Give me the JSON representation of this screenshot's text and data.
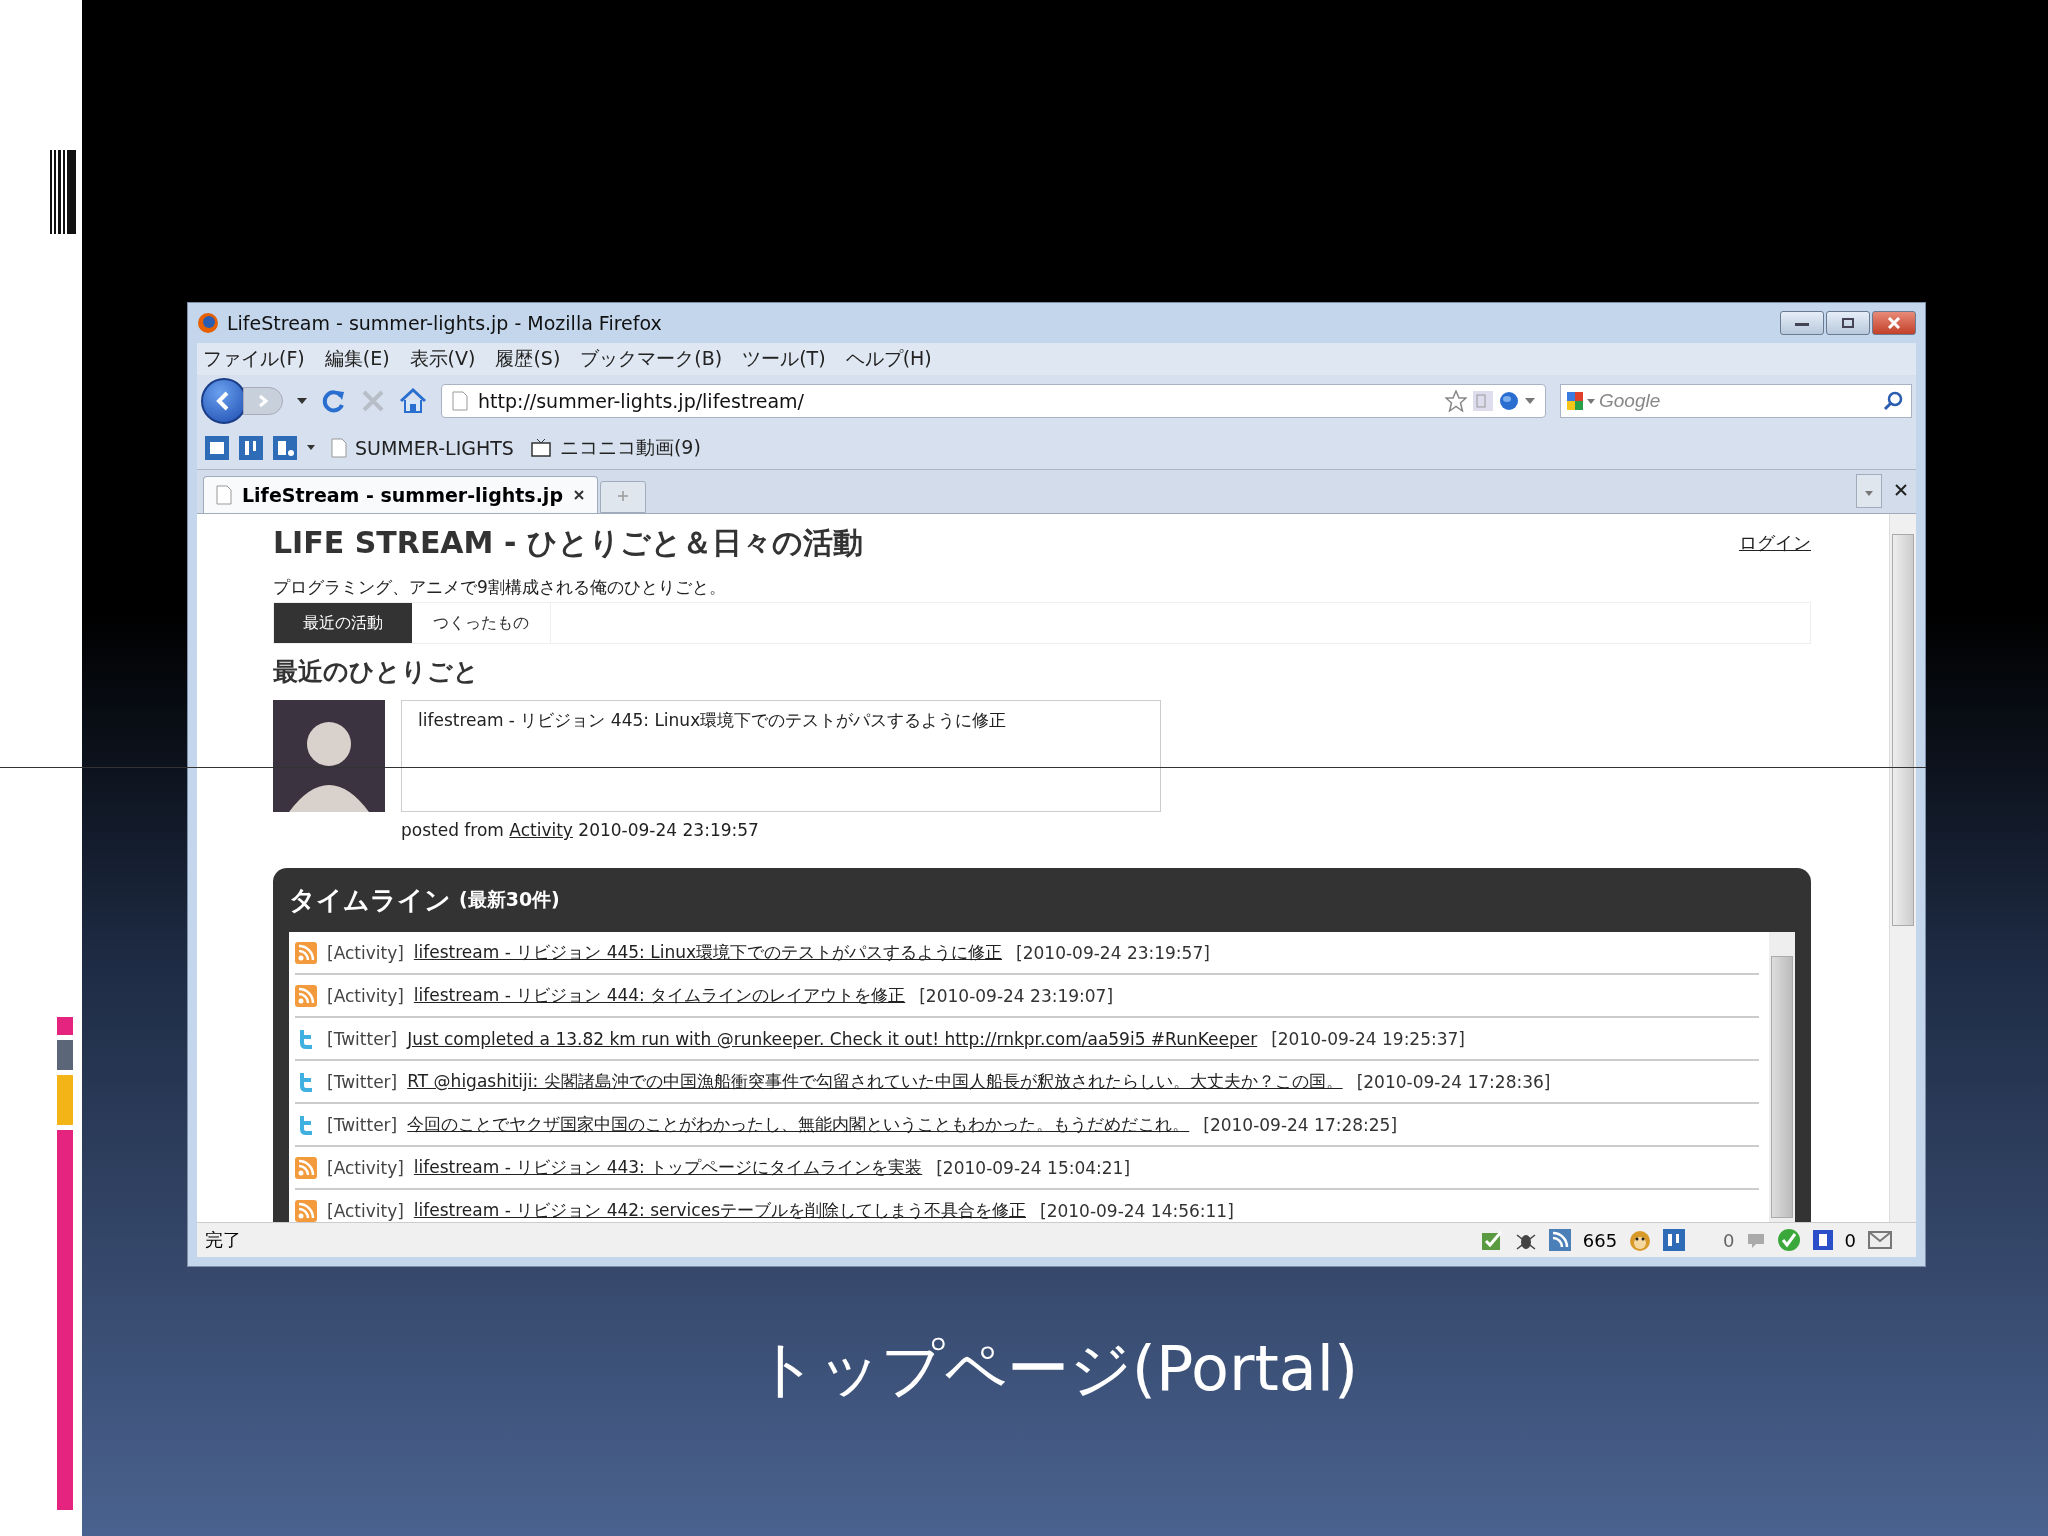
{
  "slide": {
    "caption": "トップページ(Portal)"
  },
  "window": {
    "title": "LifeStream - summer-lights.jp - Mozilla Firefox"
  },
  "menu": [
    "ファイル(F)",
    "編集(E)",
    "表示(V)",
    "履歴(S)",
    "ブックマーク(B)",
    "ツール(T)",
    "ヘルプ(H)"
  ],
  "address_bar": {
    "value": "http://summer-lights.jp/lifestream/"
  },
  "search": {
    "placeholder": "Google"
  },
  "bookmarks": [
    {
      "label": "SUMMER-LIGHTS",
      "kind": "page"
    },
    {
      "label": "ニコニコ動画(9)",
      "kind": "tv"
    }
  ],
  "tabs": [
    {
      "label": "LifeStream - summer-lights.jp",
      "selected": true
    }
  ],
  "page": {
    "title": "LIFE STREAM - ひとりごと＆日々の活動",
    "subtitle": "プログラミング、アニメで9割構成される俺のひとりごと。",
    "login": "ログイン",
    "nav": [
      {
        "label": "最近の活動",
        "selected": true
      },
      {
        "label": "つくったもの",
        "selected": false
      }
    ],
    "section_title": "最近のひとりごと",
    "latest": {
      "text": "lifestream - リビジョン 445: Linux環境下でのテストがパスするように修正",
      "posted_prefix": "posted from",
      "source": "Activity",
      "time": "2010-09-24 23:19:57"
    },
    "timeline": {
      "title": "タイムライン",
      "count": "(最新30件)",
      "items": [
        {
          "kind": "activity",
          "source": "[Activity]",
          "text": "lifestream - リビジョン 445: Linux環境下でのテストがパスするように修正",
          "time": "[2010-09-24 23:19:57]"
        },
        {
          "kind": "activity",
          "source": "[Activity]",
          "text": "lifestream - リビジョン 444: タイムラインのレイアウトを修正",
          "time": "[2010-09-24 23:19:07]"
        },
        {
          "kind": "twitter",
          "source": "[Twitter]",
          "text": "Just completed a 13.82 km run with @runkeeper. Check it out! http://rnkpr.com/aa59i5 #RunKeeper",
          "time": "[2010-09-24 19:25:37]"
        },
        {
          "kind": "twitter",
          "source": "[Twitter]",
          "text": "RT @higashitiji: 尖閣諸島沖での中国漁船衝突事件で勾留されていた中国人船長が釈放されたらしい。大丈夫か？この国。",
          "time": "[2010-09-24 17:28:36]"
        },
        {
          "kind": "twitter",
          "source": "[Twitter]",
          "text": "今回のことでヤクザ国家中国のことがわかったし、無能内閣ということもわかった。もうだめだこれ。",
          "time": "[2010-09-24 17:28:25]"
        },
        {
          "kind": "activity",
          "source": "[Activity]",
          "text": "lifestream - リビジョン 443: トップページにタイムラインを実装",
          "time": "[2010-09-24 15:04:21]"
        },
        {
          "kind": "activity",
          "source": "[Activity]",
          "text": "lifestream - リビジョン 442: servicesテーブルを削除してしまう不具合を修正",
          "time": "[2010-09-24 14:56:11]"
        }
      ]
    }
  },
  "status_bar": {
    "text": "完了",
    "feed_count": "665",
    "comment_count": "0",
    "hatena_count": "0"
  }
}
